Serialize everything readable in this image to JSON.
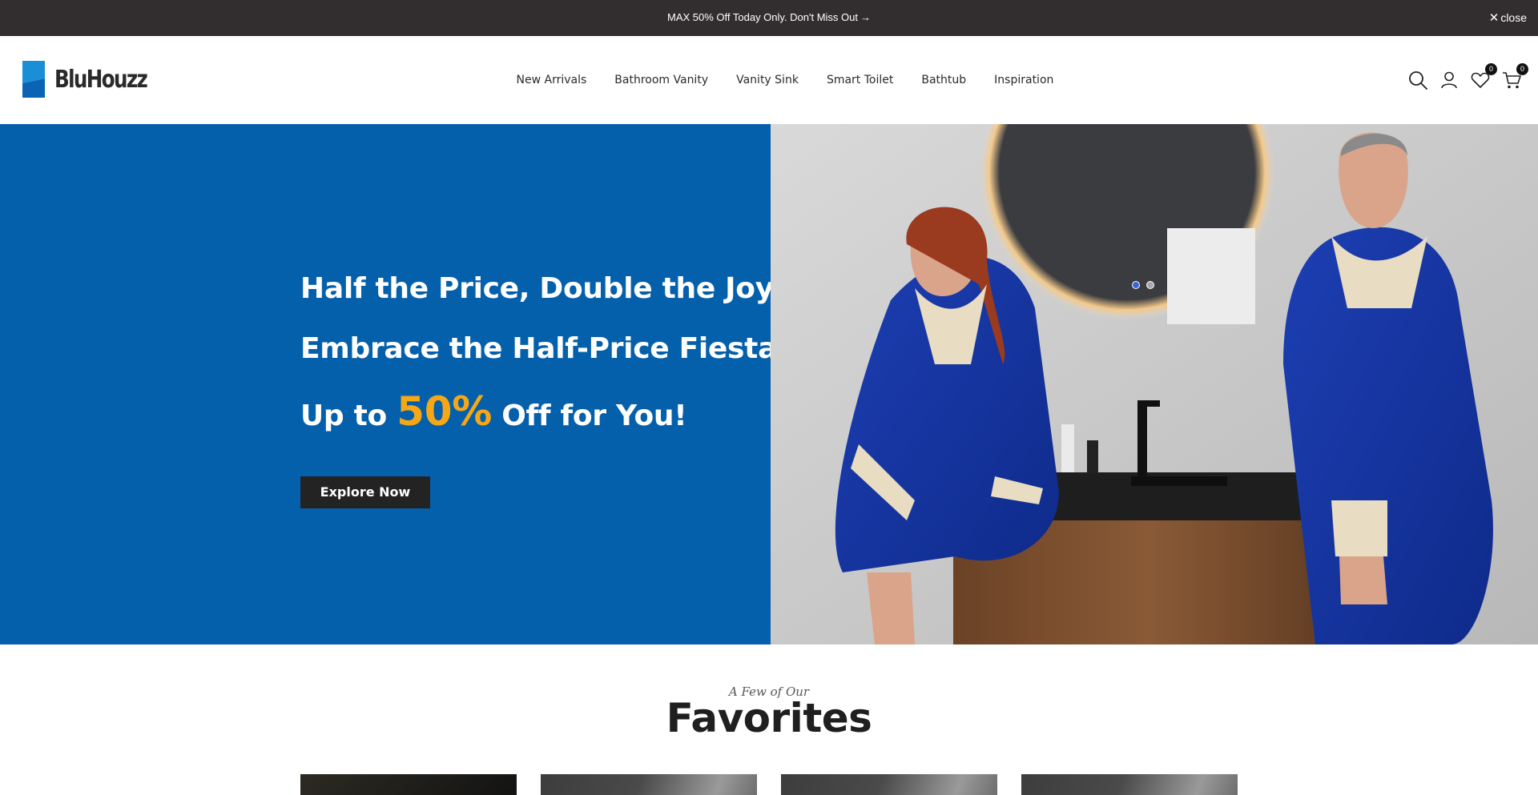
{
  "announcement": {
    "text": "MAX 50% Off Today Only. Don't Miss Out",
    "arrow": "→",
    "close_glyph": "✕",
    "close_label": "close"
  },
  "header": {
    "logo_text": "BluHouzz",
    "nav": [
      "New Arrivals",
      "Bathroom Vanity",
      "Vanity Sink",
      "Smart Toilet",
      "Bathtub",
      "Inspiration"
    ],
    "wishlist_count": "0",
    "cart_count": "0",
    "icons": [
      "search-icon",
      "account-icon",
      "heart-icon",
      "cart-icon"
    ]
  },
  "hero": {
    "line1": "Half the Price, Double the Joy:",
    "line2": "Embrace the Half-Price Fiesta:",
    "line3_pre": "Up to",
    "line3_highlight": "50%",
    "line3_post": "Off for You!",
    "button_label": "Explore Now",
    "slides_total": 2,
    "active_slide": 1,
    "colors": {
      "panel": "#0560ac",
      "highlight": "#f5a716",
      "button": "#232324"
    }
  },
  "favorites": {
    "subtitle": "A Few of Our",
    "title": "Favorites",
    "cards": 4
  }
}
